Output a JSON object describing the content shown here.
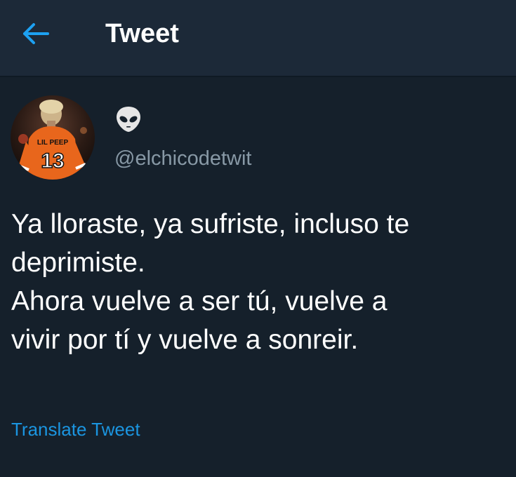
{
  "header": {
    "title": "Tweet",
    "back_icon": "back-arrow-icon",
    "accent_color": "#1da1f2"
  },
  "tweet": {
    "author": {
      "display_name_icon": "alien-emoji-icon",
      "handle": "@elchicodetwit",
      "avatar": {
        "jersey_name": "LIL PEEP",
        "jersey_number": "13"
      }
    },
    "text_lines": [
      "Ya lloraste, ya sufriste, incluso te",
      "deprimiste.",
      "Ahora vuelve a ser tú, vuelve a",
      "vivir por tí y vuelve a sonreir."
    ],
    "translate_label": "Translate Tweet"
  },
  "colors": {
    "background": "#15202b",
    "header_background": "#1c2938",
    "secondary_text": "#8899a6",
    "link": "#1b95e0"
  }
}
